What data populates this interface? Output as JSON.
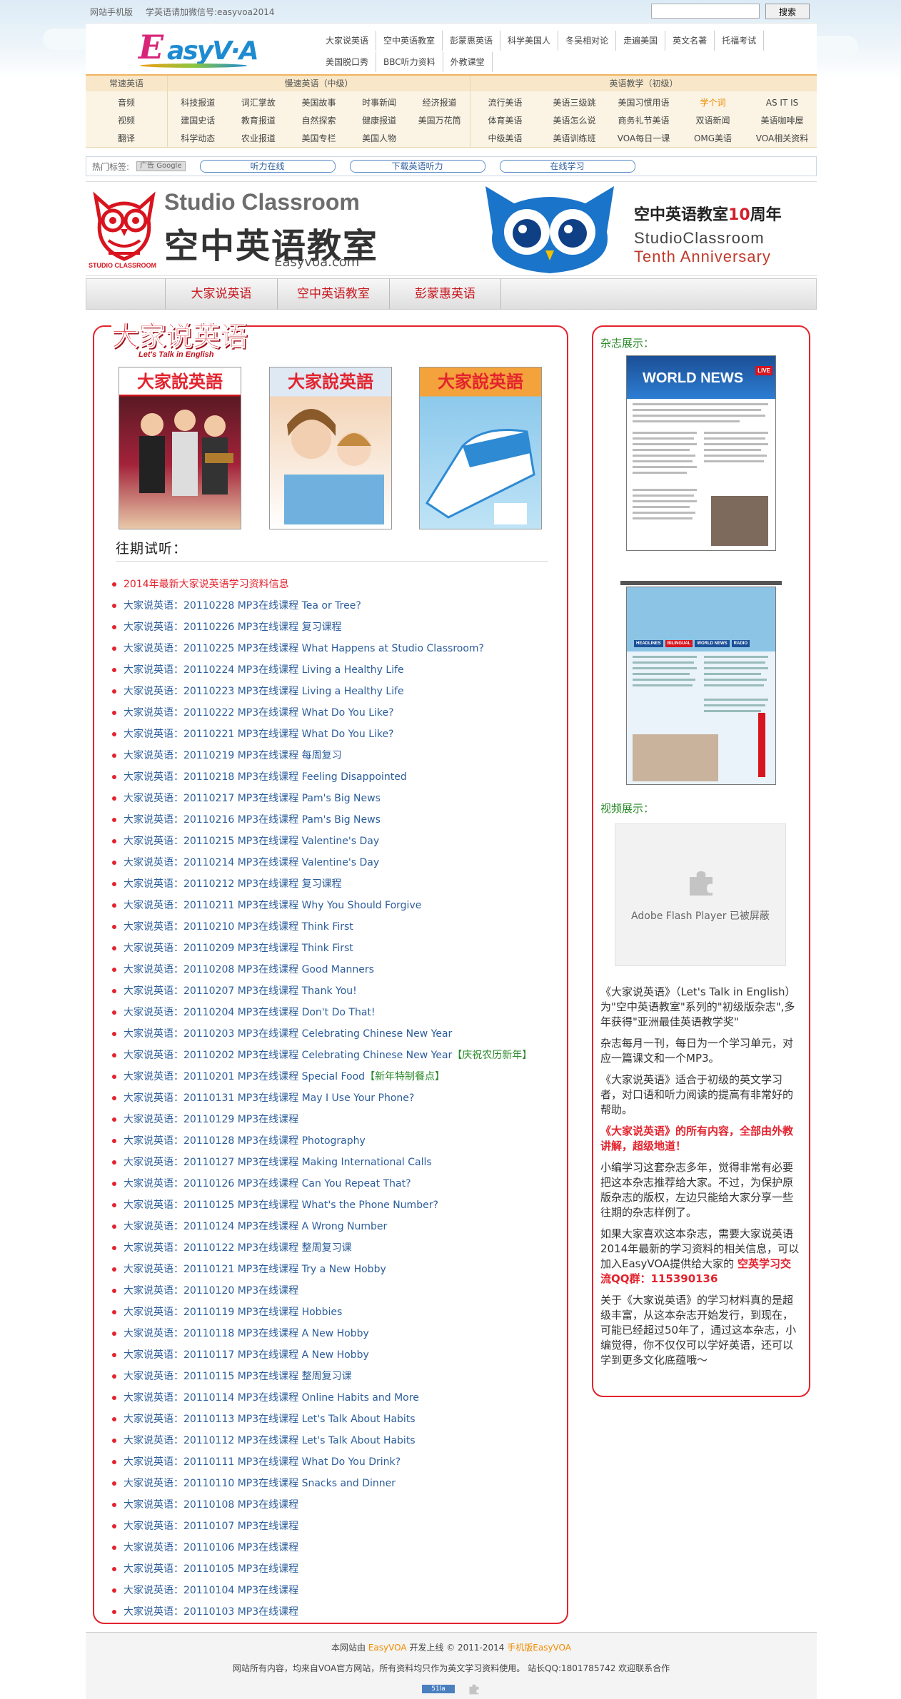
{
  "topbar": {
    "mobile_link": "网站手机版",
    "wechat_text": "学英语请加微信号:easyvoa2014",
    "search_placeholder": "",
    "search_button": "搜索"
  },
  "logo": {
    "e": "E",
    "rest": "asyV·A"
  },
  "top_nav": [
    "大家说英语",
    "空中英语教室",
    "彭蒙惠英语",
    "科学美国人",
    "冬吴相对论",
    "走遍美国",
    "英文名著",
    "托福考试",
    "美国脱口秀",
    "BBC听力资料",
    "外教课堂"
  ],
  "categories": {
    "changsu": {
      "title": "常速英语",
      "items": [
        "音频",
        "视频",
        "翻译"
      ]
    },
    "mansu": {
      "title": "慢速英语（中级）",
      "items": [
        "科技报道",
        "词汇掌故",
        "美国故事",
        "时事新闻",
        "经济报道",
        "建国史话",
        "教育报道",
        "自然探索",
        "健康报道",
        "美国万花筒",
        "科学动态",
        "农业报道",
        "美国专栏",
        "美国人物"
      ]
    },
    "jiaoxue": {
      "title": "英语教学（初级）",
      "items": [
        "流行美语",
        "美语三级跳",
        "美国习惯用语",
        "学个词",
        "AS IT IS",
        "体育美语",
        "美语怎么说",
        "商务礼节美语",
        "双语新闻",
        "美语咖啡屋",
        "中级美语",
        "美语训练班",
        "VOA每日一课",
        "OMG美语",
        "VOA相关资料"
      ]
    }
  },
  "hot_tags": {
    "label": "热门标签:",
    "ad": "广告 Google",
    "tags": [
      "听力在线",
      "下载英语听力",
      "在线学习"
    ]
  },
  "banner": {
    "owl_label": "STUDIO CLASSROOM",
    "title_en": "Studio Classroom",
    "title_cn": "空中英语教室",
    "url": "Easyvoa.com",
    "anniv_cn_pre": "空中英语教室",
    "anniv_num": "10",
    "anniv_cn_post": "周年",
    "anniv_en1": "StudioClassroom",
    "anniv_en2": "Tenth Anniversary"
  },
  "tabs": [
    "大家说英语",
    "空中英语教室",
    "彭蒙惠英语"
  ],
  "left": {
    "logo_cn": "大家说英语",
    "logo_en": "Let's Talk in English",
    "covers": [
      "大家說英語",
      "大家說英語",
      "大家說英語"
    ],
    "past_title": "往期试听：",
    "items": [
      {
        "text": "2014年最新大家说英语学习资料信息",
        "red": true
      },
      {
        "text": "大家说英语：20110228 MP3在线课程 Tea or Tree?"
      },
      {
        "text": "大家说英语：20110226 MP3在线课程 复习课程"
      },
      {
        "text": "大家说英语：20110225 MP3在线课程 What Happens at Studio Classroom?"
      },
      {
        "text": "大家说英语：20110224 MP3在线课程 Living a Healthy Life"
      },
      {
        "text": "大家说英语：20110223 MP3在线课程 Living a Healthy Life"
      },
      {
        "text": "大家说英语：20110222 MP3在线课程 What Do You Like?"
      },
      {
        "text": "大家说英语：20110221 MP3在线课程 What Do You Like?"
      },
      {
        "text": "大家说英语：20110219 MP3在线课程 每周复习"
      },
      {
        "text": "大家说英语：20110218 MP3在线课程 Feeling Disappointed"
      },
      {
        "text": "大家说英语：20110217 MP3在线课程 Pam's Big News"
      },
      {
        "text": "大家说英语：20110216 MP3在线课程 Pam's Big News"
      },
      {
        "text": "大家说英语：20110215 MP3在线课程 Valentine's Day"
      },
      {
        "text": "大家说英语：20110214 MP3在线课程 Valentine's Day"
      },
      {
        "text": "大家说英语：20110212 MP3在线课程 复习课程"
      },
      {
        "text": "大家说英语：20110211 MP3在线课程 Why You Should Forgive"
      },
      {
        "text": "大家说英语：20110210 MP3在线课程 Think First"
      },
      {
        "text": "大家说英语：20110209 MP3在线课程 Think First"
      },
      {
        "text": "大家说英语：20110208 MP3在线课程 Good Manners"
      },
      {
        "text": "大家说英语：20110207 MP3在线课程 Thank You!"
      },
      {
        "text": "大家说英语：20110204 MP3在线课程 Don't Do That!"
      },
      {
        "text": "大家说英语：20110203 MP3在线课程 Celebrating Chinese New Year"
      },
      {
        "text": "大家说英语：20110202 MP3在线课程 Celebrating Chinese New Year",
        "suffix": "【庆祝农历新年】"
      },
      {
        "text": "大家说英语：20110201 MP3在线课程 Special Food",
        "suffix": "【新年特制餐点】"
      },
      {
        "text": "大家说英语：20110131 MP3在线课程 May I Use Your Phone?"
      },
      {
        "text": "大家说英语：20110129 MP3在线课程"
      },
      {
        "text": "大家说英语：20110128 MP3在线课程 Photography"
      },
      {
        "text": "大家说英语：20110127 MP3在线课程 Making International Calls"
      },
      {
        "text": "大家说英语：20110126 MP3在线课程 Can You Repeat That?"
      },
      {
        "text": "大家说英语：20110125 MP3在线课程 What's the Phone Number?"
      },
      {
        "text": "大家说英语：20110124 MP3在线课程 A Wrong Number"
      },
      {
        "text": "大家说英语：20110122 MP3在线课程 整周复习课"
      },
      {
        "text": "大家说英语：20110121 MP3在线课程 Try a New Hobby"
      },
      {
        "text": "大家说英语：20110120 MP3在线课程"
      },
      {
        "text": "大家说英语：20110119 MP3在线课程 Hobbies"
      },
      {
        "text": "大家说英语：20110118 MP3在线课程 A New Hobby"
      },
      {
        "text": "大家说英语：20110117 MP3在线课程 A New Hobby"
      },
      {
        "text": "大家说英语：20110115 MP3在线课程 整周复习课"
      },
      {
        "text": "大家说英语：20110114 MP3在线课程 Online Habits and More"
      },
      {
        "text": "大家说英语：20110113 MP3在线课程 Let's Talk About Habits"
      },
      {
        "text": "大家说英语：20110112 MP3在线课程 Let's Talk About Habits"
      },
      {
        "text": "大家说英语：20110111 MP3在线课程 What Do You Drink?"
      },
      {
        "text": "大家说英语：20110110 MP3在线课程 Snacks and Dinner"
      },
      {
        "text": "大家说英语：20110108 MP3在线课程"
      },
      {
        "text": "大家说英语：20110107 MP3在线课程"
      },
      {
        "text": "大家说英语：20110106 MP3在线课程"
      },
      {
        "text": "大家说英语：20110105 MP3在线课程"
      },
      {
        "text": "大家说英语：20110104 MP3在线课程"
      },
      {
        "text": "大家说英语：20110103 MP3在线课程"
      }
    ]
  },
  "right": {
    "mag_label": "杂志展示：",
    "mag_page1_title": "WORLD NEWS",
    "mag_page1_tag": "LIVE",
    "mag_page2_tabs": [
      "HEADLINES",
      "BILINGUAL",
      "WORLD NEWS",
      "RADIO"
    ],
    "video_label": "视频展示：",
    "flash_text": "Adobe Flash Player 已被屏蔽",
    "paragraphs": [
      "《大家说英语》（Let's Talk in English）为\"空中英语教室\"系列的\"初级版杂志\",多年获得\"亚洲最佳英语教学奖\"",
      "杂志每月一刊，每日为一个学习单元，对应一篇课文和一个MP3。",
      "《大家说英语》适合于初级的英文学习者，对口语和听力阅读的提高有非常好的帮助。",
      "《大家说英语》的所有内容，全部由外教讲解，超级地道！",
      "小编学习这套杂志多年，觉得非常有必要把这本杂志推荐给大家。不过，为保护原版杂志的版权，左边只能给大家分享一些往期的杂志样例了。",
      "如果大家喜欢这本杂志，需要大家说英语2014年最新的学习资料的相关信息，可以加入EasyVOA提供给大家的",
      "空英学习交流QQ群：115390136",
      "关于《大家说英语》的学习材料真的是超级丰富，从这本杂志开始发行，到现在，可能已经超过50年了，通过这本杂志，小编觉得，你不仅仅可以学好英语，还可以学到更多文化底蕴哦～"
    ]
  },
  "footer": {
    "line1_pre": "本网站由",
    "line1_brand": "EasyVOA",
    "line1_mid": "开发上线 © 2011-2014",
    "line1_mobile": "手机版EasyVOA",
    "line2": "网站所有内容，均来自VOA官方网站，所有资料均只作为英文学习资料使用。 站长QQ:1801785742 欢迎联系合作",
    "badge": "51la"
  },
  "colors": {
    "accent_red": "#e3232e",
    "link_blue": "#2b5d9b",
    "label_green": "#2a8a2a",
    "brand_orange": "#f08c00"
  }
}
